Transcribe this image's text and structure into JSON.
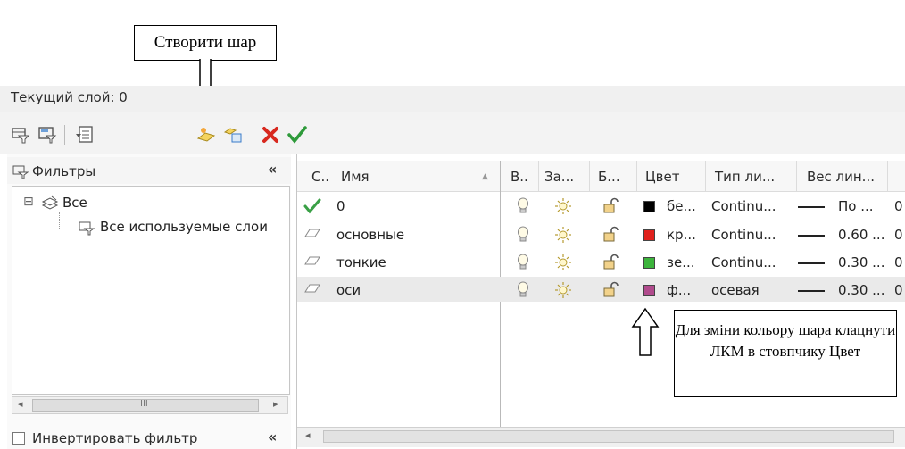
{
  "callouts": {
    "create_layer": "Створити шар",
    "change_color": "Для зміни кольору шара клацнути ЛКМ в стовпчику Цвет"
  },
  "header": {
    "current_layer": "Текущий слой: 0"
  },
  "toolbar": {
    "icons": [
      "new-filter-icon",
      "filter-icon",
      "layer-states-icon",
      "new-layer-icon",
      "new-layer-vp-icon",
      "delete-icon",
      "set-current-icon"
    ]
  },
  "filters": {
    "title": "Фильтры",
    "collapse": "«",
    "tree": [
      {
        "expander": "⊟",
        "label": "Все"
      },
      {
        "label": "Все используемые слои"
      }
    ],
    "invert_label": "Инвертировать фильтр",
    "scroll_glyph": "III"
  },
  "table": {
    "columns": [
      "С..",
      "Имя",
      "В..",
      "За...",
      "Б...",
      "Цвет",
      "Тип ли...",
      "Вес лин..."
    ],
    "rows": [
      {
        "status": "current",
        "name": "0",
        "color_hex": "#000000",
        "color_name": "бе...",
        "linetype": "Continu...",
        "weight": "По ...",
        "extra": "0"
      },
      {
        "status": "layer",
        "name": "основные",
        "color_hex": "#e0201c",
        "color_name": "кр...",
        "linetype": "Continu...",
        "weight": "0.60 ...",
        "extra": "0"
      },
      {
        "status": "layer",
        "name": "тонкие",
        "color_hex": "#3cb43c",
        "color_name": "зе...",
        "linetype": "Continu...",
        "weight": "0.30 ...",
        "extra": "0"
      },
      {
        "status": "layer",
        "name": "оси",
        "color_hex": "#b04a8c",
        "color_name": "ф...",
        "linetype": "осевая",
        "weight": "0.30 ...",
        "extra": "0"
      }
    ]
  }
}
